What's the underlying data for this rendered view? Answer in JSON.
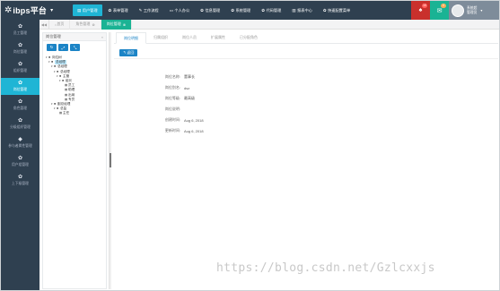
{
  "brand": {
    "name": "ibps平台",
    "logo_icon": "star-icon",
    "caret": "▾"
  },
  "top_nav": [
    {
      "label": "用户管理",
      "icon": "▤"
    },
    {
      "label": "表单管理",
      "icon": "✿"
    },
    {
      "label": "工作流程",
      "icon": "✎"
    },
    {
      "label": "个人办公",
      "icon": "▭"
    },
    {
      "label": "信息管理",
      "icon": "✿"
    },
    {
      "label": "系统管理",
      "icon": "✿"
    },
    {
      "label": "代码管理",
      "icon": "✿"
    },
    {
      "label": "报表中心",
      "icon": "▥"
    },
    {
      "label": "快速配置菜单",
      "icon": "✿"
    }
  ],
  "notifications": {
    "messages_count": "10",
    "mail_count": "0"
  },
  "user": {
    "line1": "系统超",
    "line2": "管理员",
    "caret": "▾"
  },
  "sidebar": [
    {
      "label": "员工管理",
      "icon": "✿",
      "active": false
    },
    {
      "label": "岗位管理",
      "icon": "✿",
      "active": false
    },
    {
      "label": "组织管理",
      "icon": "✿",
      "active": false
    },
    {
      "label": "岗位管理",
      "icon": "✿",
      "active": true
    },
    {
      "label": "角色管理",
      "icon": "✿",
      "active": false
    },
    {
      "label": "分级组织管理",
      "icon": "✿",
      "active": false
    },
    {
      "label": "参与者属性管理",
      "icon": "◆",
      "active": false
    },
    {
      "label": "用户组管理",
      "icon": "✿",
      "active": false
    },
    {
      "label": "上下级管理",
      "icon": "✿",
      "active": false
    }
  ],
  "tabs": {
    "prev": "◀◀",
    "items": [
      {
        "label": "首页",
        "icon": "⌂",
        "active": false,
        "close": ""
      },
      {
        "label": "角色管理",
        "icon": "",
        "active": false,
        "close": "⊗"
      },
      {
        "label": "岗位管理",
        "icon": "",
        "active": true,
        "close": "⊗"
      }
    ]
  },
  "tree_panel": {
    "title": "岗位管理",
    "collapse": "«",
    "tools": [
      "↻",
      "⤢",
      "⤡"
    ],
    "nodes": [
      {
        "label": "岗位树",
        "depth": 0,
        "toggle": "▾",
        "icon": "■",
        "selected": false
      },
      {
        "label": "总经理",
        "depth": 1,
        "toggle": "▾",
        "icon": "■",
        "selected": true
      },
      {
        "label": "总经理",
        "depth": 2,
        "toggle": "▾",
        "icon": "■",
        "selected": false
      },
      {
        "label": "总经理",
        "depth": 3,
        "toggle": "▾",
        "icon": "■",
        "selected": false
      },
      {
        "label": "主管",
        "depth": 4,
        "toggle": "▾",
        "icon": "■",
        "selected": false
      },
      {
        "label": "组长",
        "depth": 5,
        "toggle": "▾",
        "icon": "■",
        "selected": false
      },
      {
        "label": "员工",
        "depth": 6,
        "toggle": "",
        "icon": "▦",
        "selected": false
      },
      {
        "label": "助理",
        "depth": 6,
        "toggle": "",
        "icon": "▦",
        "selected": false
      },
      {
        "label": "出纳",
        "depth": 6,
        "toggle": "",
        "icon": "▦",
        "selected": false
      },
      {
        "label": "专员",
        "depth": 6,
        "toggle": "",
        "icon": "▦",
        "selected": false
      },
      {
        "label": "副总经理",
        "depth": 2,
        "toggle": "▾",
        "icon": "■",
        "selected": false
      },
      {
        "label": "总监",
        "depth": 3,
        "toggle": "▾",
        "icon": "■",
        "selected": false
      },
      {
        "label": "主任",
        "depth": 4,
        "toggle": "",
        "icon": "▦",
        "selected": false
      }
    ]
  },
  "subtabs": [
    {
      "label": "岗位明细",
      "active": true
    },
    {
      "label": "归属组织",
      "active": false
    },
    {
      "label": "岗位人员",
      "active": false
    },
    {
      "label": "扩展属性",
      "active": false
    },
    {
      "label": "已分配角色",
      "active": false
    }
  ],
  "back_button": {
    "label": "返回",
    "icon": "↰"
  },
  "details": [
    {
      "label": "岗位名称:",
      "value": "董事长"
    },
    {
      "label": "岗位别名:",
      "value": "dsz"
    },
    {
      "label": "岗位等级:",
      "value": "最高级"
    },
    {
      "label": "岗位说明:",
      "value": ""
    },
    {
      "label": "创建时间:",
      "value": "Aug 6, 2018"
    },
    {
      "label": "更新时间:",
      "value": "Aug 6, 2018"
    }
  ],
  "watermark": "https://blog.csdn.net/Gzlcxxjs",
  "colors": {
    "sidebar_bg": "#2f4050",
    "accent": "#1fb5d5",
    "primary_button": "#1c84c6",
    "active_tab": "#1ab394"
  }
}
